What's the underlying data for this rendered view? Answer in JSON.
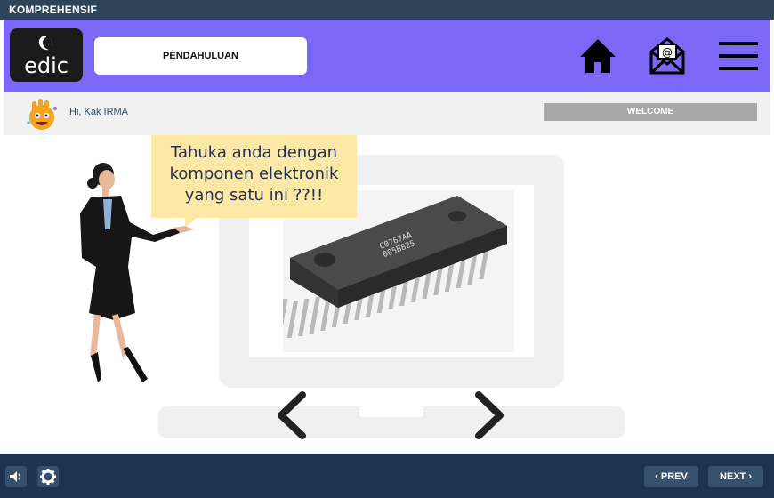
{
  "app": {
    "title": "KOMPREHENSIF"
  },
  "header": {
    "logo_text": "edic",
    "section_label": "PENDAHULUAN",
    "icons": [
      "home-icon",
      "mail-icon",
      "menu-icon"
    ]
  },
  "greeting": {
    "text": "Hi, Kak IRMA",
    "welcome_label": "WELCOME"
  },
  "content": {
    "bubble_text": "Tahuka anda dengan komponen elektronik yang satu ini ??!!",
    "chip_label_line1": "C0767AA",
    "chip_label_line2": "005B825"
  },
  "footer": {
    "prev_label": "‹ PREV",
    "next_label": "NEXT ›",
    "icons": [
      "speaker-icon",
      "gear-icon"
    ]
  },
  "colors": {
    "titlebar": "#2e4358",
    "header": "#7b68f7",
    "bubble": "#fde9a5",
    "footer": "#1d3350",
    "footer_button": "#36506d"
  }
}
